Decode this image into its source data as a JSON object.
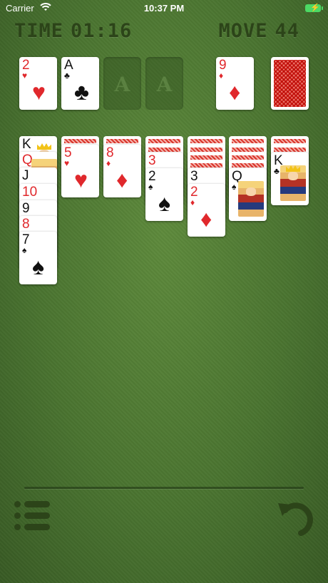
{
  "status_bar": {
    "carrier": "Carrier",
    "time": "10:37 PM"
  },
  "header": {
    "time_label": "TIME",
    "time_value": "01:16",
    "move_label": "MOVE",
    "move_value": "44"
  },
  "top_row": {
    "foundation_1": {
      "rank": "2",
      "suit": "♥",
      "color": "red"
    },
    "foundation_2": {
      "rank": "A",
      "suit": "♣",
      "color": "black"
    },
    "foundation_3_placeholder": "A",
    "foundation_4_placeholder": "A",
    "waste": {
      "rank": "9",
      "suit": "♦",
      "color": "red"
    },
    "stock": "card-back"
  },
  "tableau": [
    {
      "hidden": 0,
      "cards": [
        {
          "rank": "K",
          "suit": "",
          "color": "black"
        },
        {
          "rank": "Q",
          "suit": "",
          "color": "red"
        },
        {
          "rank": "J",
          "suit": "",
          "color": "black"
        },
        {
          "rank": "10",
          "suit": "",
          "color": "red"
        },
        {
          "rank": "9",
          "suit": "",
          "color": "black"
        },
        {
          "rank": "8",
          "suit": "",
          "color": "red"
        },
        {
          "rank": "7",
          "suit": "♠",
          "color": "black"
        }
      ]
    },
    {
      "hidden": 1,
      "cards": [
        {
          "rank": "5",
          "suit": "♥",
          "color": "red"
        }
      ]
    },
    {
      "hidden": 1,
      "cards": [
        {
          "rank": "8",
          "suit": "♦",
          "color": "red"
        }
      ]
    },
    {
      "hidden": 2,
      "cards": [
        {
          "rank": "3",
          "suit": "",
          "color": "red"
        },
        {
          "rank": "2",
          "suit": "♠",
          "color": "black"
        }
      ]
    },
    {
      "hidden": 4,
      "cards": [
        {
          "rank": "3",
          "suit": "",
          "color": "black"
        },
        {
          "rank": "2",
          "suit": "♦",
          "color": "red"
        }
      ]
    },
    {
      "hidden": 4,
      "cards": [
        {
          "rank": "Q",
          "suit": "♠",
          "color": "black"
        }
      ]
    },
    {
      "hidden": 2,
      "cards": [
        {
          "rank": "K",
          "suit": "♣",
          "color": "black"
        }
      ]
    }
  ],
  "toolbar": {
    "menu_icon": "list-icon",
    "undo_icon": "undo-icon"
  },
  "colors": {
    "felt": "#4a7430",
    "header_text": "#2c4419",
    "red_suit": "#e0282c"
  }
}
